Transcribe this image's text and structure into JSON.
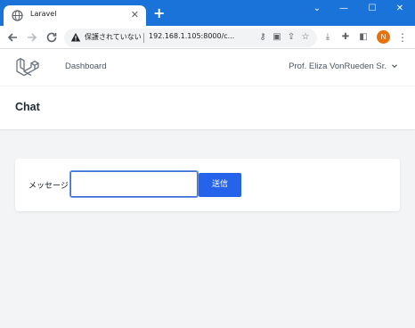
{
  "browser": {
    "tab": {
      "title": "Laravel",
      "icon": "globe-icon"
    },
    "close_tab_glyph": "✕",
    "new_tab_glyph": "+",
    "window_controls": {
      "minimize": "—",
      "maximize": "☐",
      "close": "✕",
      "collapse": "⌄"
    },
    "address_bar": {
      "security_text": "保護されていない",
      "url": "192.168.1.105:8000/c..."
    },
    "profile_initial": "N"
  },
  "app": {
    "nav": {
      "dashboard_label": "Dashboard",
      "user_name": "Prof. Eliza VonRueden Sr."
    },
    "header": {
      "title": "Chat"
    },
    "form": {
      "message_label": "メッセージ :",
      "message_value": "",
      "send_label": "送信"
    }
  },
  "colors": {
    "titlebar": "#1a73d9",
    "send_button": "#2563eb",
    "background": "#f3f4f6",
    "profile": "#e8710a"
  }
}
